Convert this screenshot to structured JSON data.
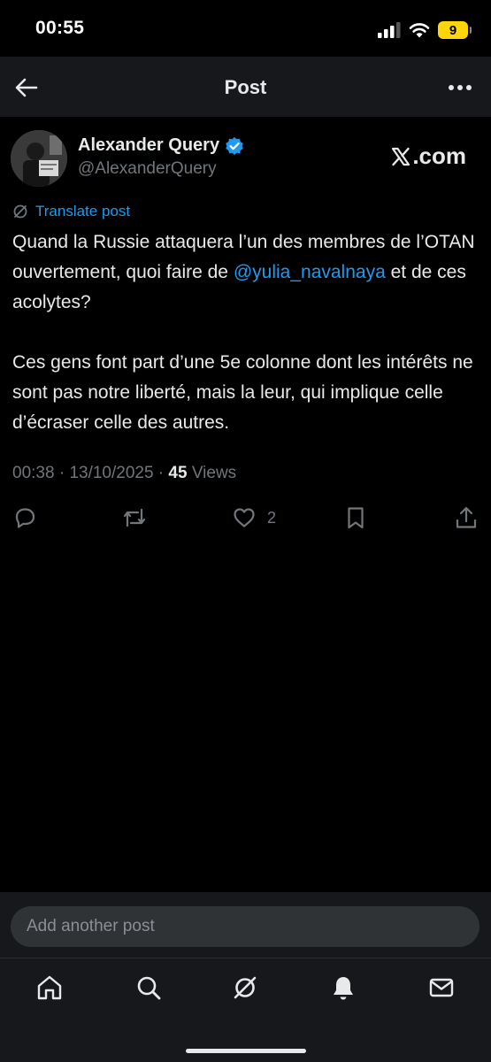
{
  "status_bar": {
    "time": "00:55",
    "battery_level": "9"
  },
  "header": {
    "title": "Post"
  },
  "author": {
    "display_name": "Alexander Query",
    "handle": "@AlexanderQuery",
    "verified": true
  },
  "watermark": "X.com",
  "translate_label": "Translate post",
  "post": {
    "line1": "Quand la Russie attaquera l’un des membres de l’OTAN ouvertement, quoi faire de ",
    "mention": "@yulia_navalnaya",
    "line1_end": " et de ces acolytes?",
    "paragraph2": "Ces gens font part d’une 5e colonne dont les intérêts ne sont pas notre liberté, mais la leur, qui implique celle d’écraser celle des autres."
  },
  "meta": {
    "time": "00:38",
    "date": "13/10/2025",
    "views_count": "45",
    "views_label": " Views"
  },
  "actions": {
    "reply_icon": "reply-icon",
    "repost_icon": "repost-icon",
    "like_icon": "heart-icon",
    "like_count": "2",
    "bookmark_icon": "bookmark-icon",
    "share_icon": "share-icon"
  },
  "compose": {
    "placeholder": "Add another post"
  },
  "tabbar": {
    "items": [
      "home-icon",
      "search-icon",
      "grok-icon",
      "notifications-icon",
      "messages-icon"
    ]
  },
  "colors": {
    "accent": "#1d9bf0",
    "background": "#000000",
    "secondary_text": "#71767b"
  }
}
